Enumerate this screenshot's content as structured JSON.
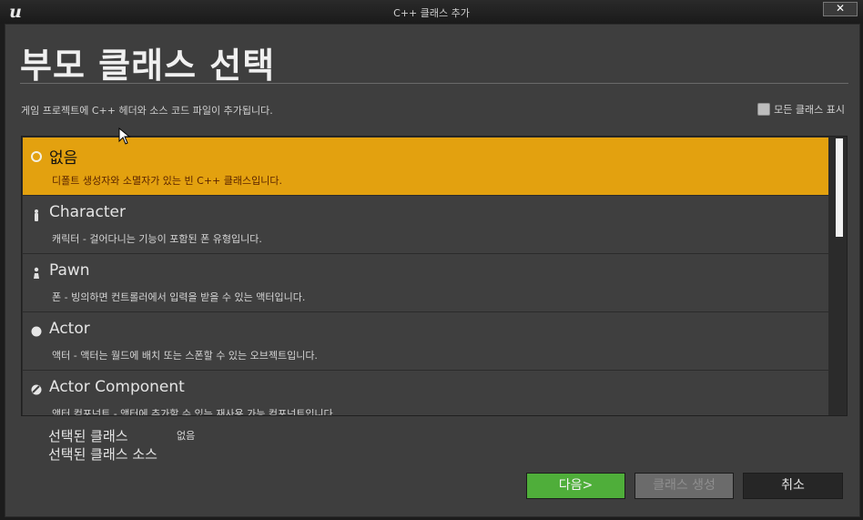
{
  "window": {
    "title": "C++ 클래스 추가",
    "close_glyph": "✕",
    "logo": "u"
  },
  "header": {
    "title": "부모 클래스 선택",
    "description": "게임 프로젝트에 C++ 헤더와 소스 코드 파일이 추가됩니다.",
    "show_all_label": "모든 클래스 표시",
    "show_all_checked": false
  },
  "classes": [
    {
      "name": "없음",
      "description": "디폴트 생성자와 소멸자가 있는 빈 C++ 클래스입니다.",
      "icon": "circle-outline-icon",
      "selected": true
    },
    {
      "name": "Character",
      "description": "캐릭터 - 걸어다니는 기능이 포함된 폰 유형입니다.",
      "icon": "character-icon",
      "selected": false
    },
    {
      "name": "Pawn",
      "description": "폰 - 빙의하면 컨트롤러에서 입력을 받을 수 있는 액터입니다.",
      "icon": "pawn-icon",
      "selected": false
    },
    {
      "name": "Actor",
      "description": "액터 - 액터는 월드에 배치 또는 스폰할 수 있는 오브젝트입니다.",
      "icon": "sphere-icon",
      "selected": false
    },
    {
      "name": "Actor Component",
      "description": "액터 컴포넌트 - 액터에 추가할 수 있는 재사용 가능 컴포넌트입니다.",
      "icon": "component-icon",
      "selected": false
    }
  ],
  "selection": {
    "class_label": "선택된 클래스",
    "class_value": "없음",
    "source_label": "선택된 클래스 소스"
  },
  "buttons": {
    "next": "다음>",
    "create": "클래스 생성",
    "cancel": "취소"
  },
  "colors": {
    "selected": "#e3a10f",
    "next": "#4fae3a"
  }
}
